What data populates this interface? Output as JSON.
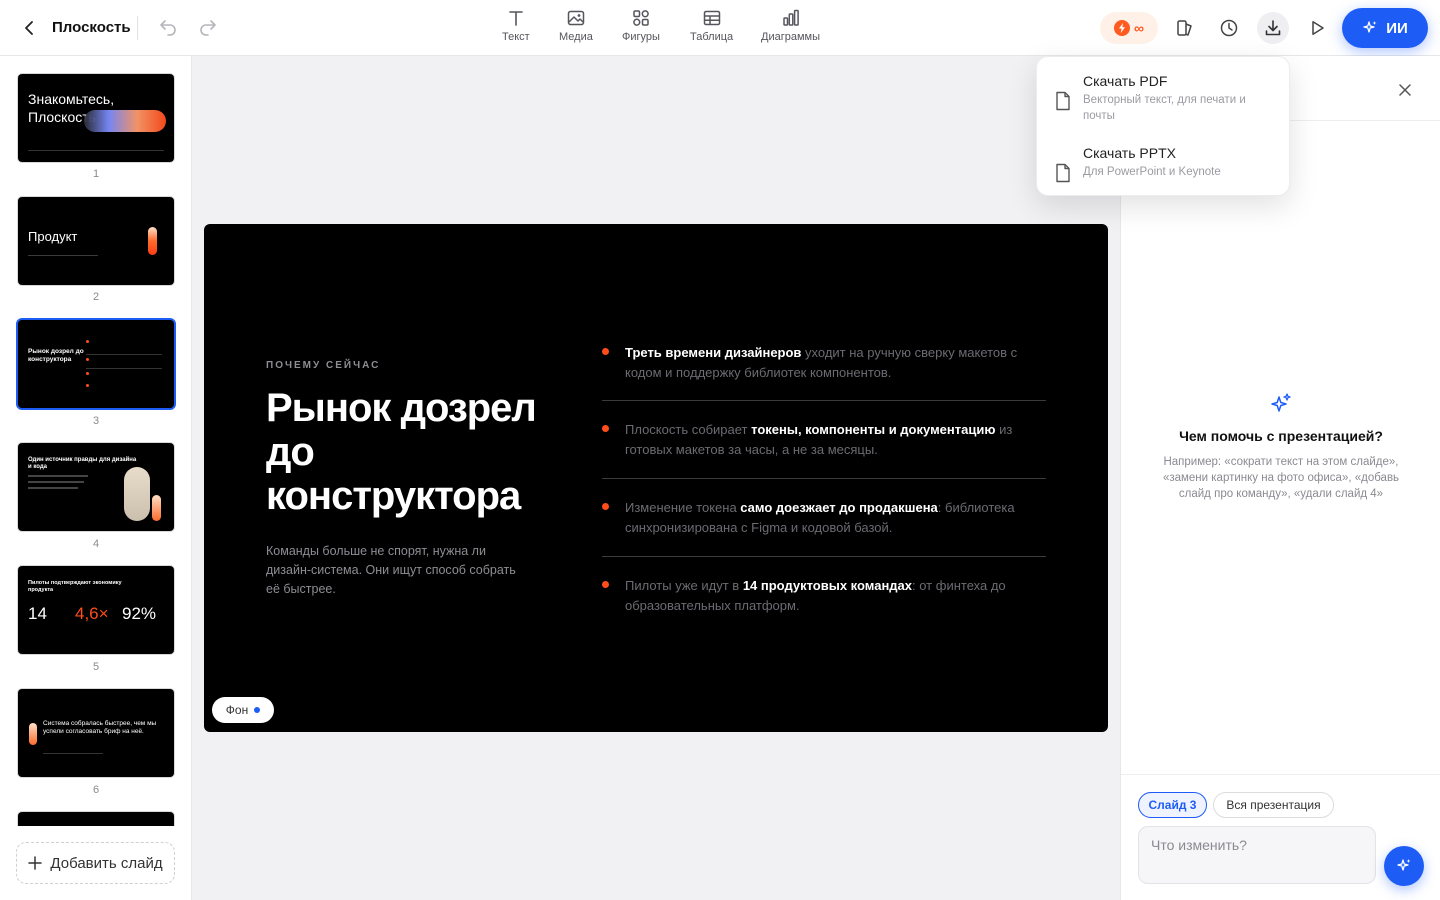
{
  "app": {
    "title": "Плоскость",
    "colors": {
      "accent": "#1e5df5",
      "orange": "#ff4d1c",
      "slide_bg": "#000000"
    }
  },
  "toolbar": {
    "tools": [
      {
        "label": "Текст",
        "icon": "text-icon"
      },
      {
        "label": "Медиа",
        "icon": "image-icon"
      },
      {
        "label": "Фигуры",
        "icon": "shapes-icon"
      },
      {
        "label": "Таблица",
        "icon": "table-icon"
      },
      {
        "label": "Диаграммы",
        "icon": "chart-icon"
      }
    ],
    "credits_label": "∞",
    "ai_label": "ИИ"
  },
  "download_menu": {
    "items": [
      {
        "title": "Скачать PDF",
        "subtitle": "Векторный текст, для печати и почты"
      },
      {
        "title": "Скачать PPTX",
        "subtitle": "Для PowerPoint и Keynote"
      }
    ]
  },
  "sidebar": {
    "slides": [
      {
        "number": "1",
        "title": "Знакомьтесь, Плоскость"
      },
      {
        "number": "2",
        "title": "Продукт"
      },
      {
        "number": "3",
        "title": "Рынок дозрел до конструктора",
        "selected": true
      },
      {
        "number": "4",
        "title": "Один источник правды для дизайна и кода"
      },
      {
        "number": "5",
        "title": "Пилоты подтверждают экономику продукта",
        "stats": [
          "14",
          "4,6×",
          "92%"
        ]
      },
      {
        "number": "6",
        "title": "Система собралась быстрее, чем мы успели согласовать бриф на неё."
      }
    ],
    "add_slide_label": "Добавить слайд"
  },
  "slide": {
    "eyebrow": "ПОЧЕМУ СЕЙЧАС",
    "headline": "Рынок дозрел до конструктора",
    "lead": "Команды больше не спорят, нужна ли дизайн-система. Они ищут способ собрать её быстрее.",
    "bullets": [
      {
        "pre": "",
        "bold": "Треть времени дизайнеров",
        "post": " уходит на ручную сверку макетов с кодом и поддержку библиотек компонентов."
      },
      {
        "pre": "Плоскость собирает ",
        "bold": "токены, компоненты и документацию",
        "post": " из готовых макетов за часы, а не за месяцы."
      },
      {
        "pre": "Изменение токена ",
        "bold": "само доезжает до продакшена",
        "post": ": библиотека синхронизирована с Figma и кодовой базой."
      },
      {
        "pre": "Пилоты уже идут в ",
        "bold": "14 продуктовых командах",
        "post": ": от финтеха до образовательных платформ."
      }
    ],
    "background_label": "Фон"
  },
  "ai_panel": {
    "question": "Чем помочь с презентацией?",
    "hint": "Например: «сократи текст на этом слайде», «замени картинку на фото офиса», «добавь слайд про команду», «удали слайд 4»",
    "chips": [
      "Слайд 3",
      "Вся презентация"
    ],
    "input_placeholder": "Что изменить?"
  }
}
